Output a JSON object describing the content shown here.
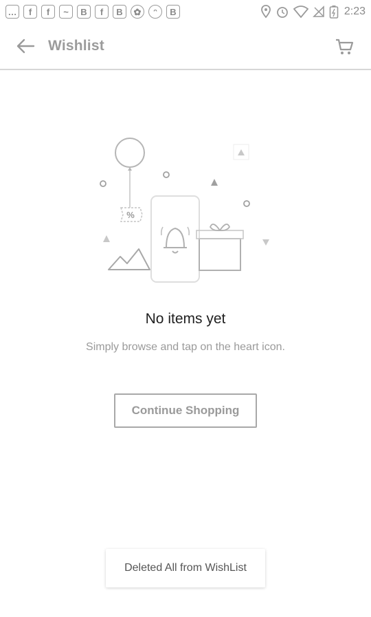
{
  "status_bar": {
    "time": "2:23",
    "notification_icons": [
      "chat-icon",
      "facebook-icon",
      "facebook-icon",
      "messenger-icon",
      "b-icon",
      "facebook-icon",
      "b-icon",
      "pinwheel-icon",
      "cat-icon",
      "b-icon"
    ],
    "system_icons": [
      "location-icon",
      "alarm-icon",
      "wifi-icon",
      "no-signal-icon",
      "battery-icon"
    ]
  },
  "appbar": {
    "title": "Wishlist",
    "back_icon": "arrow-left-icon",
    "cart_icon": "cart-icon"
  },
  "empty_state": {
    "title": "No items yet",
    "subtitle": "Simply browse and tap on the heart icon.",
    "continue_label": "Continue Shopping",
    "illustration_badge": "%"
  },
  "footer": {
    "delete_all_label": "Deleted All from WishList"
  },
  "colors": {
    "background": "#ffffff",
    "icon_gray": "#9a9a9a",
    "title_text": "#1f1f1f",
    "subtitle_text": "#9a9a9a"
  }
}
